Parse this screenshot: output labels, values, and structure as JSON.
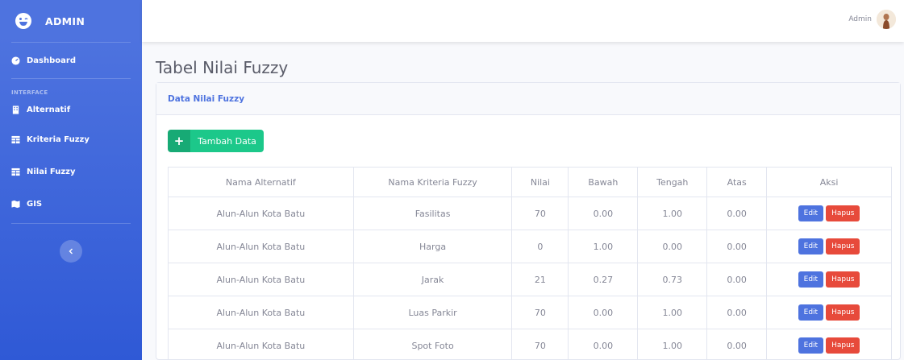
{
  "sidebar": {
    "brand": "ADMIN",
    "items": [
      {
        "label": "Dashboard",
        "icon": "dashboard-icon"
      },
      {
        "label": "Alternatif",
        "icon": "building-icon"
      },
      {
        "label": "Kriteria Fuzzy",
        "icon": "table-icon"
      },
      {
        "label": "Nilai Fuzzy",
        "icon": "table-icon"
      },
      {
        "label": "GIS",
        "icon": "map-icon"
      }
    ],
    "heading": "INTERFACE"
  },
  "topbar": {
    "user_name": "Admin"
  },
  "page": {
    "title": "Tabel Nilai Fuzzy"
  },
  "card": {
    "title": "Data Nilai Fuzzy",
    "add_button": "Tambah Data"
  },
  "table": {
    "headers": [
      "Nama Alternatif",
      "Nama Kriteria Fuzzy",
      "Nilai",
      "Bawah",
      "Tengah",
      "Atas",
      "Aksi"
    ],
    "rows": [
      [
        "Alun-Alun Kota Batu",
        "Fasilitas",
        "70",
        "0.00",
        "1.00",
        "0.00"
      ],
      [
        "Alun-Alun Kota Batu",
        "Harga",
        "0",
        "1.00",
        "0.00",
        "0.00"
      ],
      [
        "Alun-Alun Kota Batu",
        "Jarak",
        "21",
        "0.27",
        "0.73",
        "0.00"
      ],
      [
        "Alun-Alun Kota Batu",
        "Luas Parkir",
        "70",
        "0.00",
        "1.00",
        "0.00"
      ],
      [
        "Alun-Alun Kota Batu",
        "Spot Foto",
        "70",
        "0.00",
        "1.00",
        "0.00"
      ]
    ],
    "edit_label": "Edit",
    "delete_label": "Hapus"
  },
  "colors": {
    "primary": "#4e73df",
    "success": "#1cc88a",
    "danger": "#e74a3b"
  }
}
